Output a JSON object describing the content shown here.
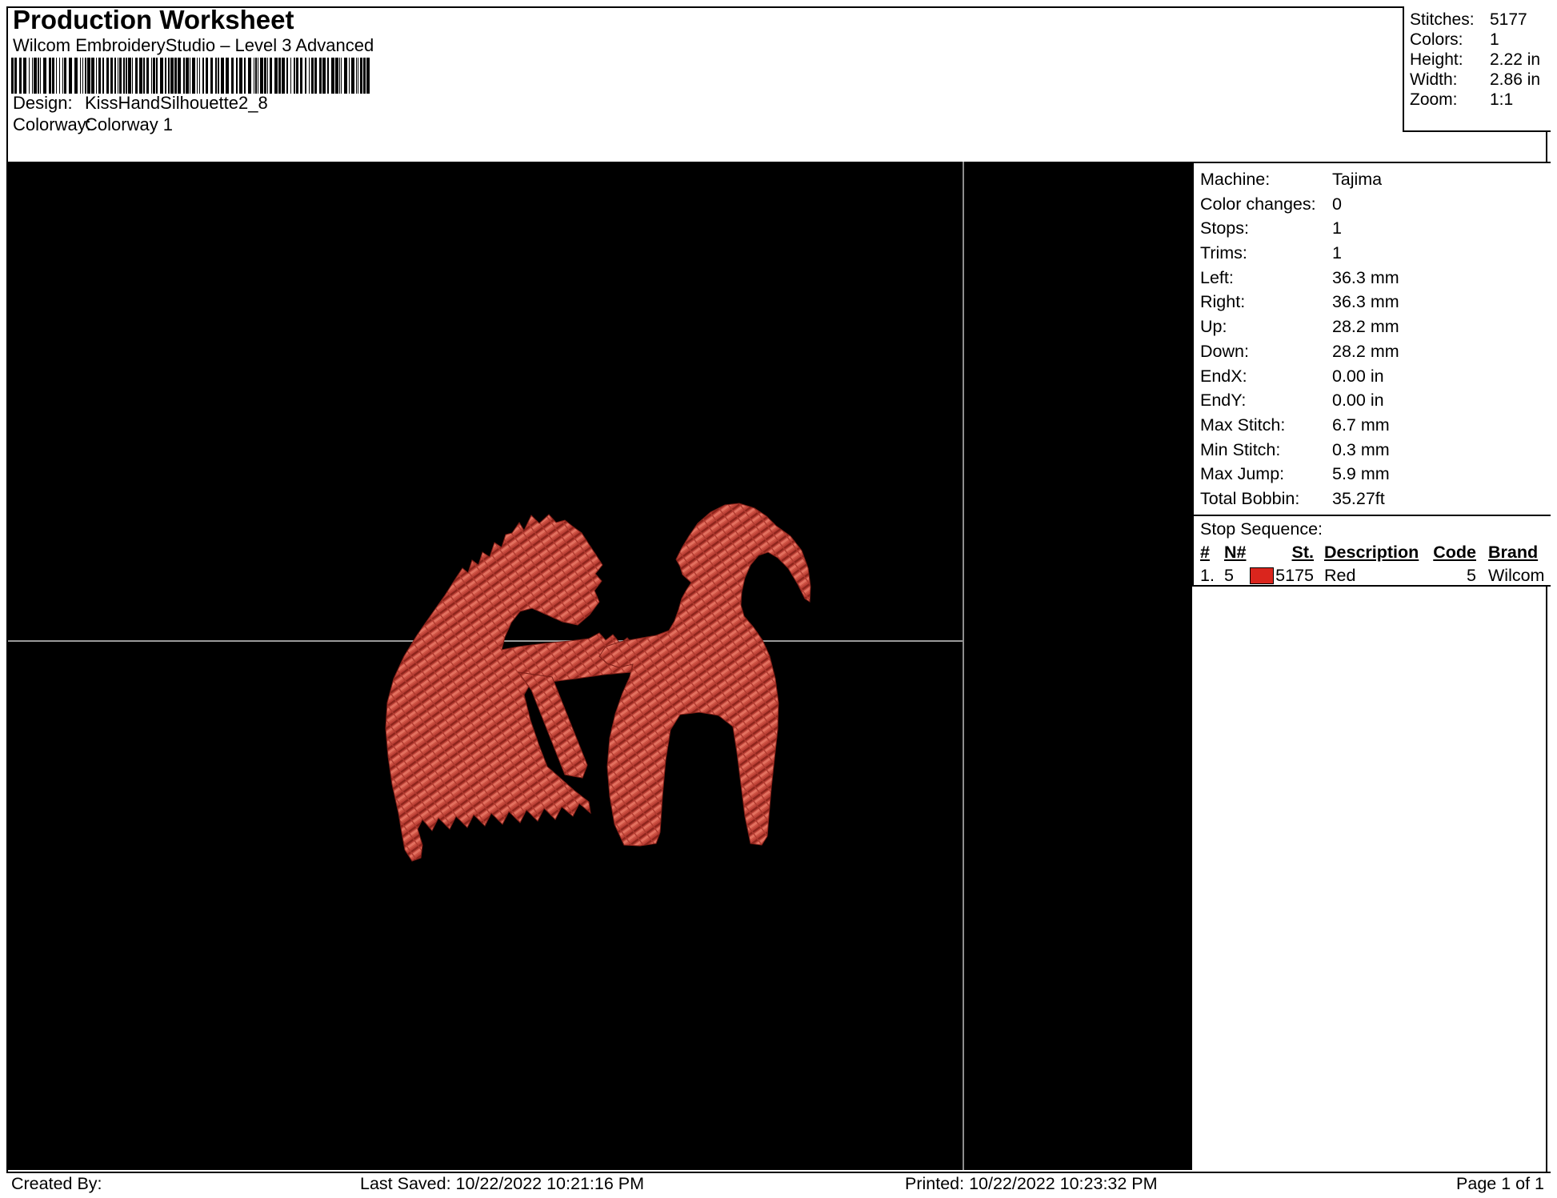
{
  "header": {
    "title": "Production Worksheet",
    "subtitle": "Wilcom EmbroideryStudio – Level 3 Advanced",
    "design_label": "Design:",
    "design_value": "KissHandSilhouette2_8",
    "colorway_label": "Colorway:",
    "colorway_value": "Colorway 1"
  },
  "summary": {
    "rows": [
      {
        "label": "Stitches:",
        "value": "5177"
      },
      {
        "label": "Colors:",
        "value": "1"
      },
      {
        "label": "Height:",
        "value": "2.22 in"
      },
      {
        "label": "Width:",
        "value": "2.86 in"
      },
      {
        "label": "Zoom:",
        "value": "1:1"
      }
    ]
  },
  "machine_info": {
    "rows": [
      {
        "label": "Machine:",
        "value": "Tajima"
      },
      {
        "label": "Color changes:",
        "value": "0"
      },
      {
        "label": "Stops:",
        "value": "1"
      },
      {
        "label": "Trims:",
        "value": "1"
      },
      {
        "label": "Left:",
        "value": "36.3 mm"
      },
      {
        "label": "Right:",
        "value": "36.3 mm"
      },
      {
        "label": "Up:",
        "value": "28.2 mm"
      },
      {
        "label": "Down:",
        "value": "28.2 mm"
      },
      {
        "label": "EndX:",
        "value": "0.00 in"
      },
      {
        "label": "EndY:",
        "value": "0.00 in"
      },
      {
        "label": "Max Stitch:",
        "value": "6.7 mm"
      },
      {
        "label": "Min Stitch:",
        "value": "0.3 mm"
      },
      {
        "label": "Max Jump:",
        "value": "5.9 mm"
      },
      {
        "label": "Total Bobbin:",
        "value": "35.27ft"
      }
    ]
  },
  "stop_sequence": {
    "title": "Stop Sequence:",
    "columns": [
      "#",
      "N#",
      "St.",
      "Description",
      "Code",
      "Brand"
    ],
    "rows": [
      {
        "num": "1.",
        "n": "5",
        "st": "5175",
        "description": "Red",
        "code": "5",
        "brand": "Wilcom",
        "swatch_color": "#da251d"
      }
    ]
  },
  "footer": {
    "created_by": "Created By:",
    "last_saved": "Last Saved: 10/22/2022 10:21:16 PM",
    "printed": "Printed: 10/22/2022 10:23:32 PM",
    "page": "Page 1 of 1"
  },
  "colors": {
    "thread_red": "#bc4036",
    "thread_red_highlight": "#e2705f",
    "thread_red_shadow": "#8e251c",
    "swatch_red": "#da251d",
    "crosshair_gray": "#9a9a9a"
  }
}
